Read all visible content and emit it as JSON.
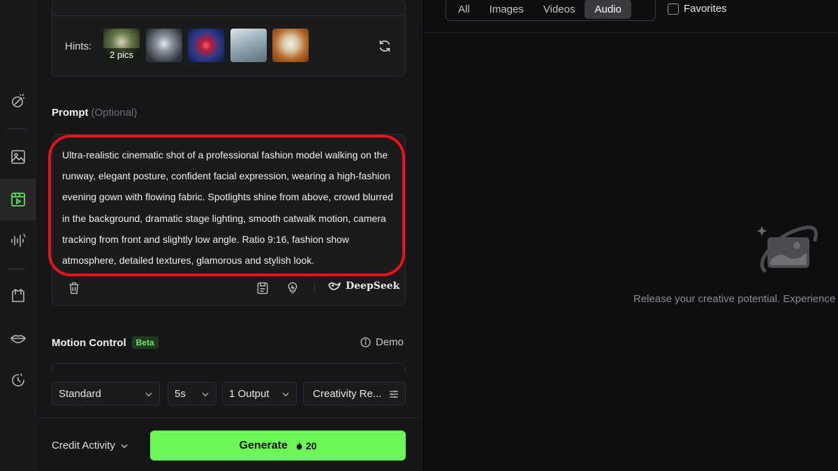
{
  "hints": {
    "label": "Hints:",
    "badge": "2 pics",
    "thumbnails": [
      "forest-figure",
      "white-robed-figure",
      "red-hooded-character",
      "ice-landscape",
      "panda-character"
    ]
  },
  "prompt": {
    "title": "Prompt",
    "optional": "(Optional)",
    "text": "Ultra-realistic cinematic shot of a professional fashion model walking on the runway, elegant posture, confident facial expression, wearing a high-fashion evening gown with flowing fabric. Spotlights shine from above, crowd blurred in the background, dramatic stage lighting, smooth catwalk motion, camera tracking from front and slightly low angle. Ratio 9:16, fashion show atmosphere, detailed textures, glamorous and stylish look.",
    "model_brand": "DeepSeek"
  },
  "motion": {
    "title": "Motion Control",
    "badge": "Beta",
    "demo": "Demo"
  },
  "options": {
    "mode": "Standard",
    "duration": "5s",
    "outputs": "1 Output",
    "creativity": "Creativity Re..."
  },
  "footer": {
    "credit": "Credit Activity",
    "generate": "Generate",
    "cost": "20"
  },
  "filters": {
    "tabs": [
      "All",
      "Images",
      "Videos",
      "Audio"
    ],
    "active": "Audio",
    "favorites": "Favorites"
  },
  "empty": {
    "message": "Release your creative potential. Experience"
  },
  "colors": {
    "accent": "#6bfa55",
    "highlight_ring": "#e8121c",
    "active_rail_icon": "#62e05a"
  }
}
